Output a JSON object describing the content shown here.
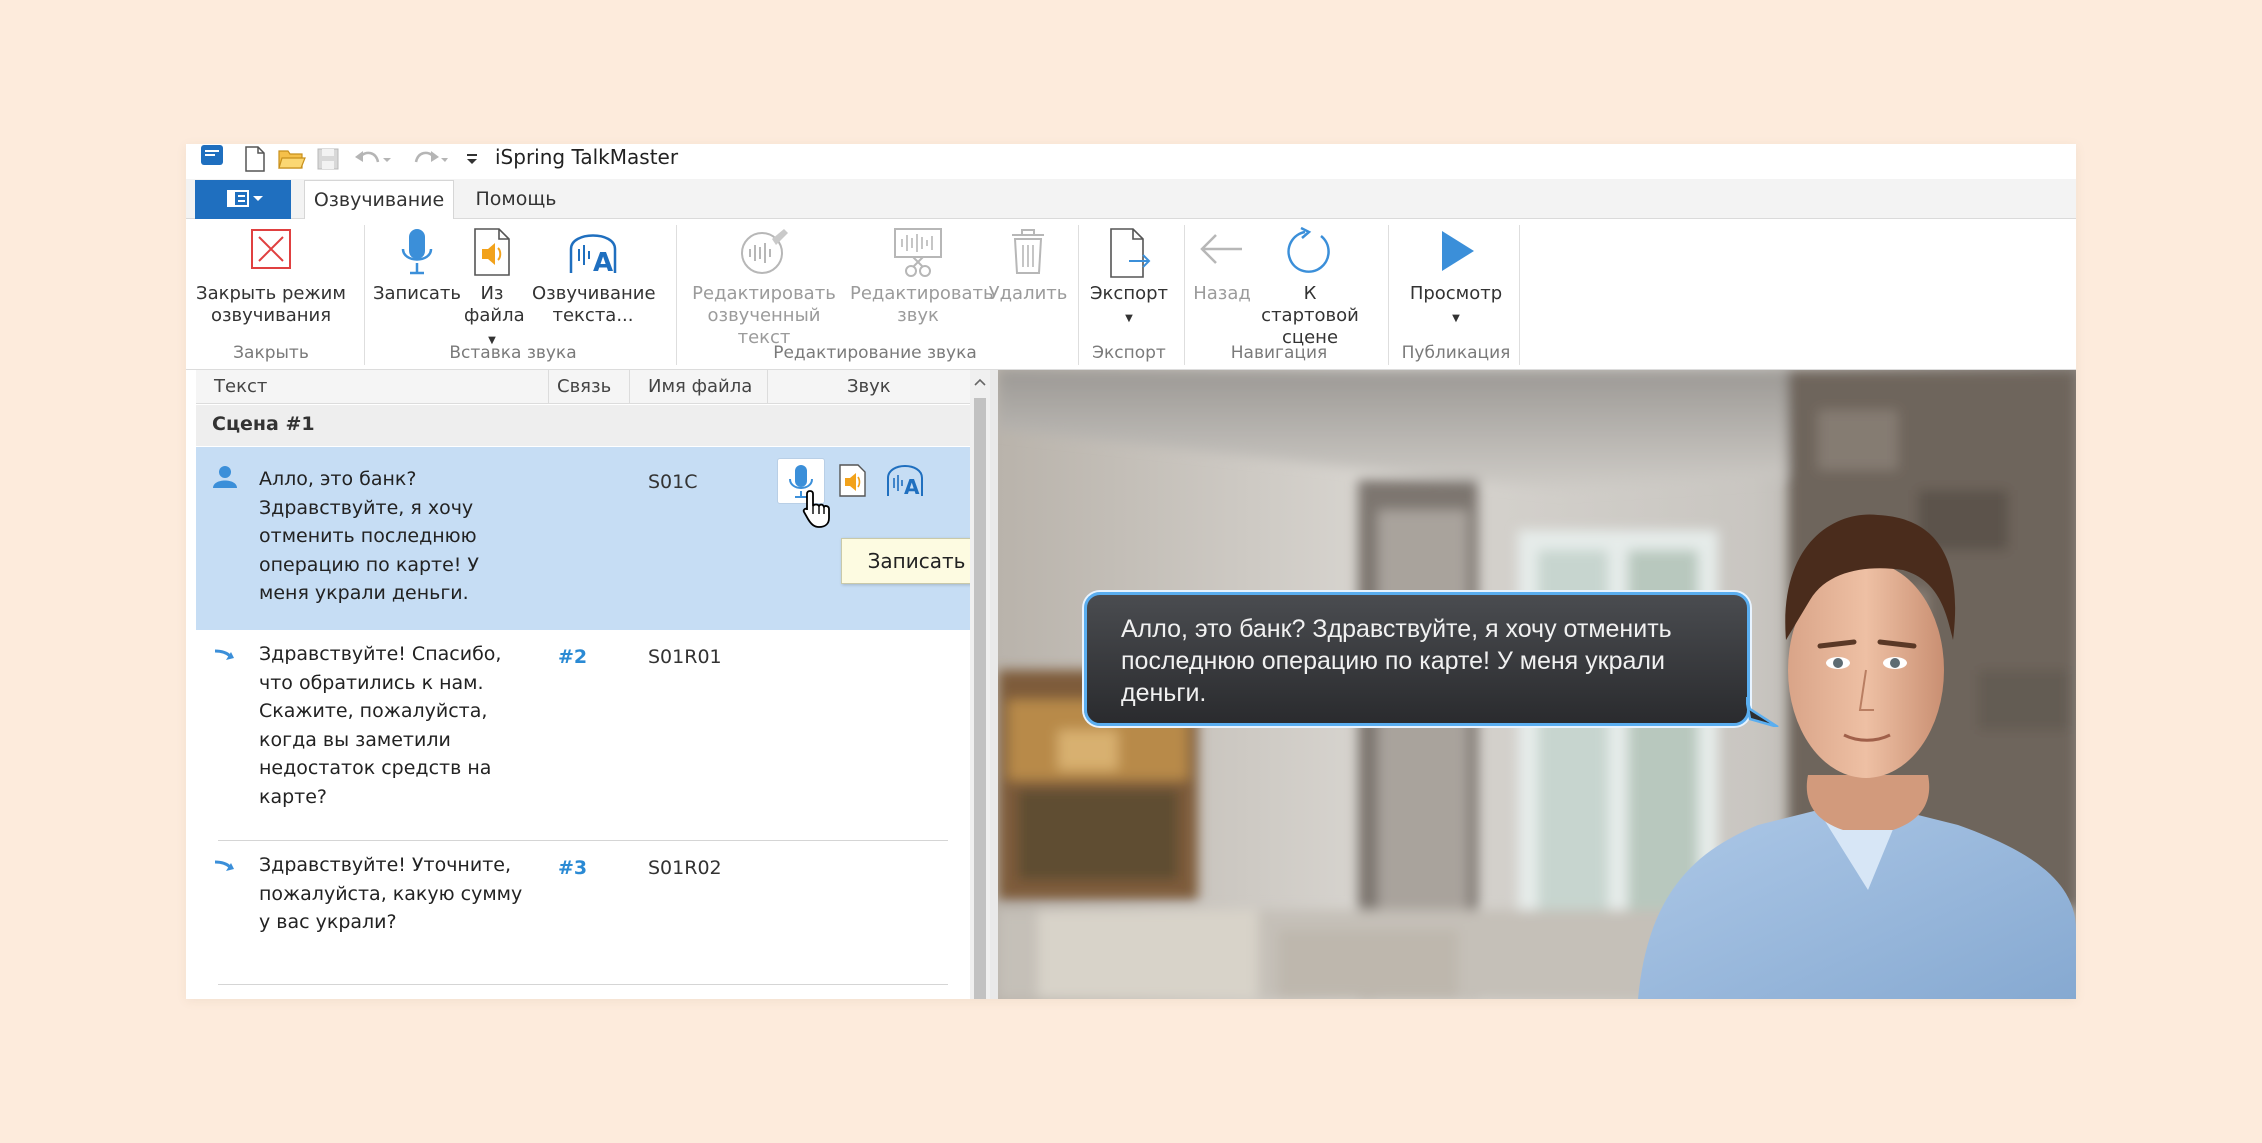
{
  "window": {
    "title": "iSpring TalkMaster"
  },
  "tabs": [
    {
      "label": "Озвучивание",
      "active": true
    },
    {
      "label": "Помощь",
      "active": false
    }
  ],
  "ribbon": {
    "close_mode": "Закрыть режим\nозвучивания",
    "record": "Записать",
    "from_file": "Из\nфайла",
    "tts": "Озвучивание\nтекста...",
    "edit_voiced_text": "Редактировать\nозвученный текст",
    "edit_sound": "Редактировать\nзвук",
    "delete": "Удалить",
    "export": "Экспорт",
    "back": "Назад",
    "to_start": "К стартовой\nсцене",
    "preview": "Просмотр",
    "groups": {
      "close": "Закрыть",
      "insert_sound": "Вставка звука",
      "edit_sound": "Редактирование звука",
      "export": "Экспорт",
      "navigation": "Навигация",
      "publish": "Публикация"
    }
  },
  "grid": {
    "headers": {
      "text": "Текст",
      "link": "Связь",
      "filename": "Имя файла",
      "sound": "Звук"
    },
    "scene": "Сцена #1",
    "rows": [
      {
        "icon": "user-icon",
        "text": "Алло, это банк? Здравствуйте, я хочу отменить последнюю операцию по карте! У меня украли деньги.",
        "link": "",
        "filename": "S01C",
        "selected": true
      },
      {
        "icon": "arrow-right-icon",
        "text": "Здравствуйте! Спасибо, что обратились к нам. Скажите, пожалуйста, когда вы заметили недостаток средств на карте?",
        "link": "#2",
        "filename": "S01R01",
        "selected": false
      },
      {
        "icon": "arrow-right-icon",
        "text": "Здравствуйте! Уточните, пожалуйста, какую сумму у вас украли?",
        "link": "#3",
        "filename": "S01R02",
        "selected": false
      }
    ],
    "tooltip": "Записать"
  },
  "preview": {
    "bubble_text": "Алло, это банк? Здравствуйте, я хочу отменить последнюю операцию по карте! У меня украли деньги."
  },
  "colors": {
    "accent": "#1f6fbf",
    "selection": "#c6ddf4",
    "link": "#2a8ad4",
    "bubble_border": "#5aaef0"
  }
}
